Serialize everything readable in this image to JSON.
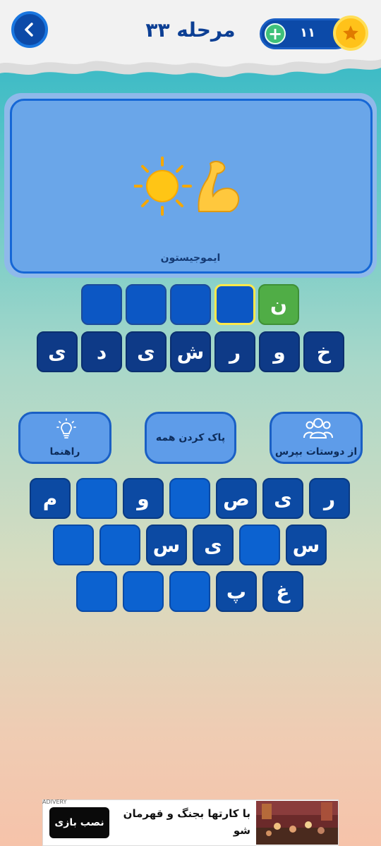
{
  "header": {
    "title": "مرحله ۳۳",
    "coins": "۱۱",
    "icons": {
      "back": "chevron-left-icon",
      "plus": "plus-icon",
      "star": "star-icon"
    }
  },
  "puzzle": {
    "emojis": [
      "flexed-biceps-emoji",
      "sun-emoji"
    ],
    "label": "ایموجیستون"
  },
  "answer_row_1": [
    "ن",
    "",
    "",
    "",
    ""
  ],
  "answer_row_2": [
    "خ",
    "و",
    "ر",
    "ش",
    "ی",
    "د",
    "ی"
  ],
  "actions": {
    "ask_friends": "از دوستات بپرس",
    "clear_all": "پاک کردن همه",
    "hint": "راهنما"
  },
  "keyboard": {
    "row1": [
      "ر",
      "ی",
      "ص",
      "",
      "و",
      "",
      "م"
    ],
    "row2": [
      "س",
      "",
      "ی",
      "س",
      "",
      ""
    ],
    "row3": [
      "غ",
      "پ",
      "",
      "",
      ""
    ]
  },
  "ad": {
    "tag": "ADIVERY",
    "button": "نصب بازی",
    "text": "با کارتها بجنگ و قهرمان شو"
  },
  "colors": {
    "accent_blue": "#0c4aa8",
    "tile_blue": "#0c57c4",
    "correct_green": "#50ad46",
    "selected_yellow": "#ffe94a",
    "coin_gold": "#ffc21a"
  }
}
